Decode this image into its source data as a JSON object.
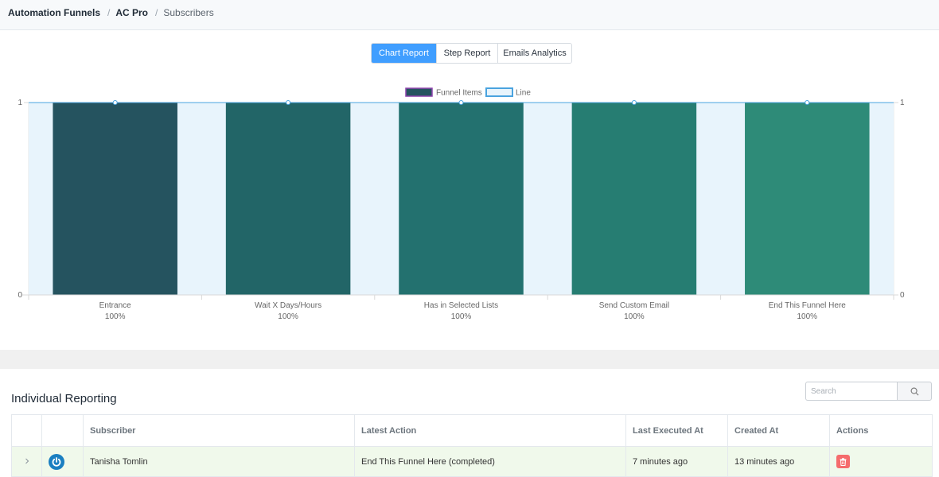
{
  "breadcrumb": {
    "items": [
      "Automation Funnels",
      "AC Pro",
      "Subscribers"
    ],
    "separator": "/"
  },
  "tabs": [
    {
      "label": "Chart Report",
      "active": true
    },
    {
      "label": "Step Report",
      "active": false
    },
    {
      "label": "Emails Analytics",
      "active": false
    }
  ],
  "chart_data": {
    "type": "bar",
    "categories": [
      "Entrance",
      "Wait X Days/Hours",
      "Has in Selected Lists",
      "Send Custom Email",
      "End This Funnel Here"
    ],
    "category_sublabels": [
      "100%",
      "100%",
      "100%",
      "100%",
      "100%"
    ],
    "series": [
      {
        "name": "Funnel Items",
        "values": [
          1,
          1,
          1,
          1,
          1
        ],
        "colors": [
          "#25535f",
          "#226567",
          "#23716f",
          "#267d72",
          "#2e8b78"
        ],
        "type": "bar"
      },
      {
        "name": "Line",
        "values": [
          1,
          1,
          1,
          1,
          1
        ],
        "color": "#4aa3df",
        "fill": "#e8f4fc",
        "type": "line"
      }
    ],
    "ylim": [
      0,
      1
    ],
    "y_ticks_left": [
      "0",
      "1"
    ],
    "y_ticks_right": [
      "0",
      "1"
    ],
    "legend_position": "top-center",
    "grid": false
  },
  "reporting": {
    "title": "Individual Reporting",
    "search_placeholder": "Search",
    "columns": [
      "",
      "",
      "Subscriber",
      "Latest Action",
      "Last Executed At",
      "Created At",
      "Actions"
    ],
    "rows": [
      {
        "subscriber": "Tanisha Tomlin",
        "latest_action": "End This Funnel Here (completed)",
        "last_executed_at": "7 minutes ago",
        "created_at": "13 minutes ago",
        "status_icon": "power-icon",
        "action_icon": "trash-icon"
      }
    ]
  },
  "colors": {
    "accent": "#409eff",
    "row_highlight": "#f0f9eb",
    "danger": "#f56c6c",
    "status_blue": "#1a7fc1"
  }
}
